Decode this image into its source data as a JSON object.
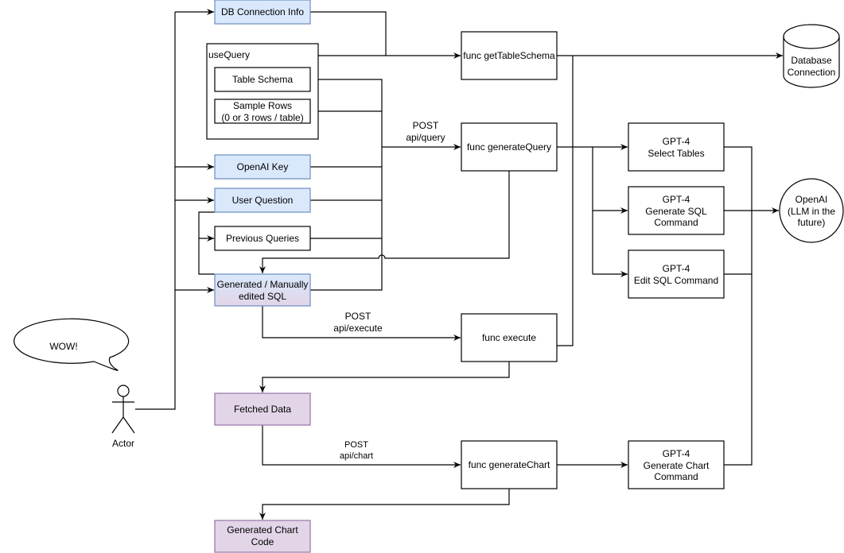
{
  "nodes": {
    "db_conn_info": "DB Connection Info",
    "use_query": "useQuery",
    "table_schema": "Table Schema",
    "sample_rows": [
      "Sample Rows",
      "(0 or 3 rows / table)"
    ],
    "openai_key": "OpenAI Key",
    "user_question": "User Question",
    "previous_queries": "Previous Queries",
    "generated_sql": [
      "Generated / Manually",
      "edited SQL"
    ],
    "fetched_data": "Fetched Data",
    "generated_chart_code": [
      "Generated Chart",
      "Code"
    ],
    "func_get_table_schema": "func getTableSchema",
    "func_generate_query": "func generateQuery",
    "func_execute": "func execute",
    "func_generate_chart": "func generateChart",
    "gpt_select_tables": [
      "GPT-4",
      "Select Tables"
    ],
    "gpt_generate_sql": [
      "GPT-4",
      "Generate SQL",
      "Command"
    ],
    "gpt_edit_sql": [
      "GPT-4",
      "Edit SQL Command"
    ],
    "gpt_generate_chart": [
      "GPT-4",
      "Generate Chart",
      "Command"
    ],
    "database": [
      "Database",
      "Connection"
    ],
    "openai": [
      "OpenAI",
      "(LLM in the",
      "future)"
    ],
    "speech_bubble": "WOW!",
    "actor": "Actor"
  },
  "edge_labels": {
    "query": [
      "POST",
      "api/query"
    ],
    "execute": [
      "POST",
      "api/execute"
    ],
    "chart": [
      "POST",
      "api/chart"
    ]
  },
  "colors": {
    "input_fill": "#dae8fc",
    "input_stroke": "#6c8ebf",
    "output_fill": "#e1d5e7",
    "output_stroke": "#9673a6"
  }
}
